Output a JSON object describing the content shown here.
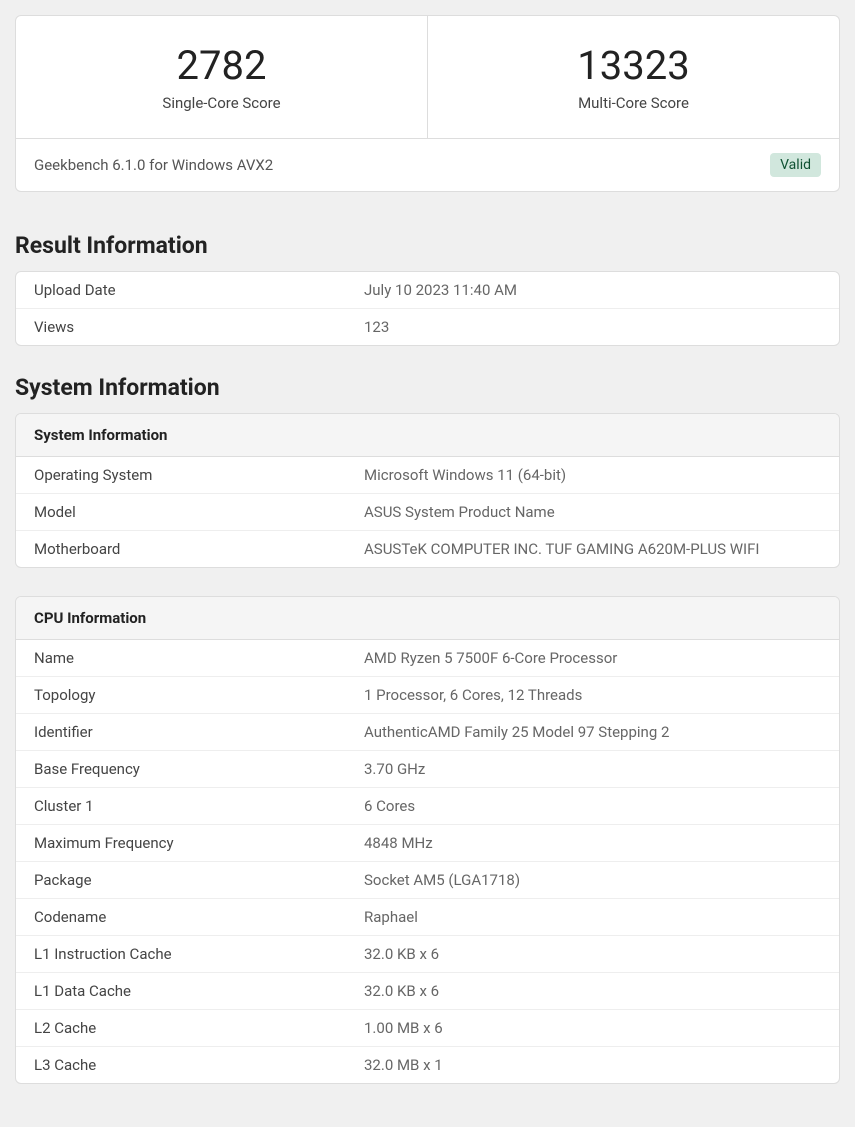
{
  "scores": {
    "single": {
      "value": "2782",
      "label": "Single-Core Score"
    },
    "multi": {
      "value": "13323",
      "label": "Multi-Core Score"
    }
  },
  "footer": {
    "version": "Geekbench 6.1.0 for Windows AVX2",
    "status": "Valid"
  },
  "result_info": {
    "title": "Result Information",
    "rows": [
      {
        "key": "Upload Date",
        "val": "July 10 2023 11:40 AM"
      },
      {
        "key": "Views",
        "val": "123"
      }
    ]
  },
  "system_info": {
    "title": "System Information",
    "header": "System Information",
    "rows": [
      {
        "key": "Operating System",
        "val": "Microsoft Windows 11 (64-bit)"
      },
      {
        "key": "Model",
        "val": "ASUS System Product Name"
      },
      {
        "key": "Motherboard",
        "val": "ASUSTeK COMPUTER INC. TUF GAMING A620M-PLUS WIFI"
      }
    ]
  },
  "cpu_info": {
    "header": "CPU Information",
    "rows": [
      {
        "key": "Name",
        "val": "AMD Ryzen 5 7500F 6-Core Processor"
      },
      {
        "key": "Topology",
        "val": "1 Processor, 6 Cores, 12 Threads"
      },
      {
        "key": "Identifier",
        "val": "AuthenticAMD Family 25 Model 97 Stepping 2"
      },
      {
        "key": "Base Frequency",
        "val": "3.70 GHz"
      },
      {
        "key": "Cluster 1",
        "val": "6 Cores"
      },
      {
        "key": "Maximum Frequency",
        "val": "4848 MHz"
      },
      {
        "key": "Package",
        "val": "Socket AM5 (LGA1718)"
      },
      {
        "key": "Codename",
        "val": "Raphael"
      },
      {
        "key": "L1 Instruction Cache",
        "val": "32.0 KB x 6"
      },
      {
        "key": "L1 Data Cache",
        "val": "32.0 KB x 6"
      },
      {
        "key": "L2 Cache",
        "val": "1.00 MB x 6"
      },
      {
        "key": "L3 Cache",
        "val": "32.0 MB x 1"
      }
    ]
  }
}
